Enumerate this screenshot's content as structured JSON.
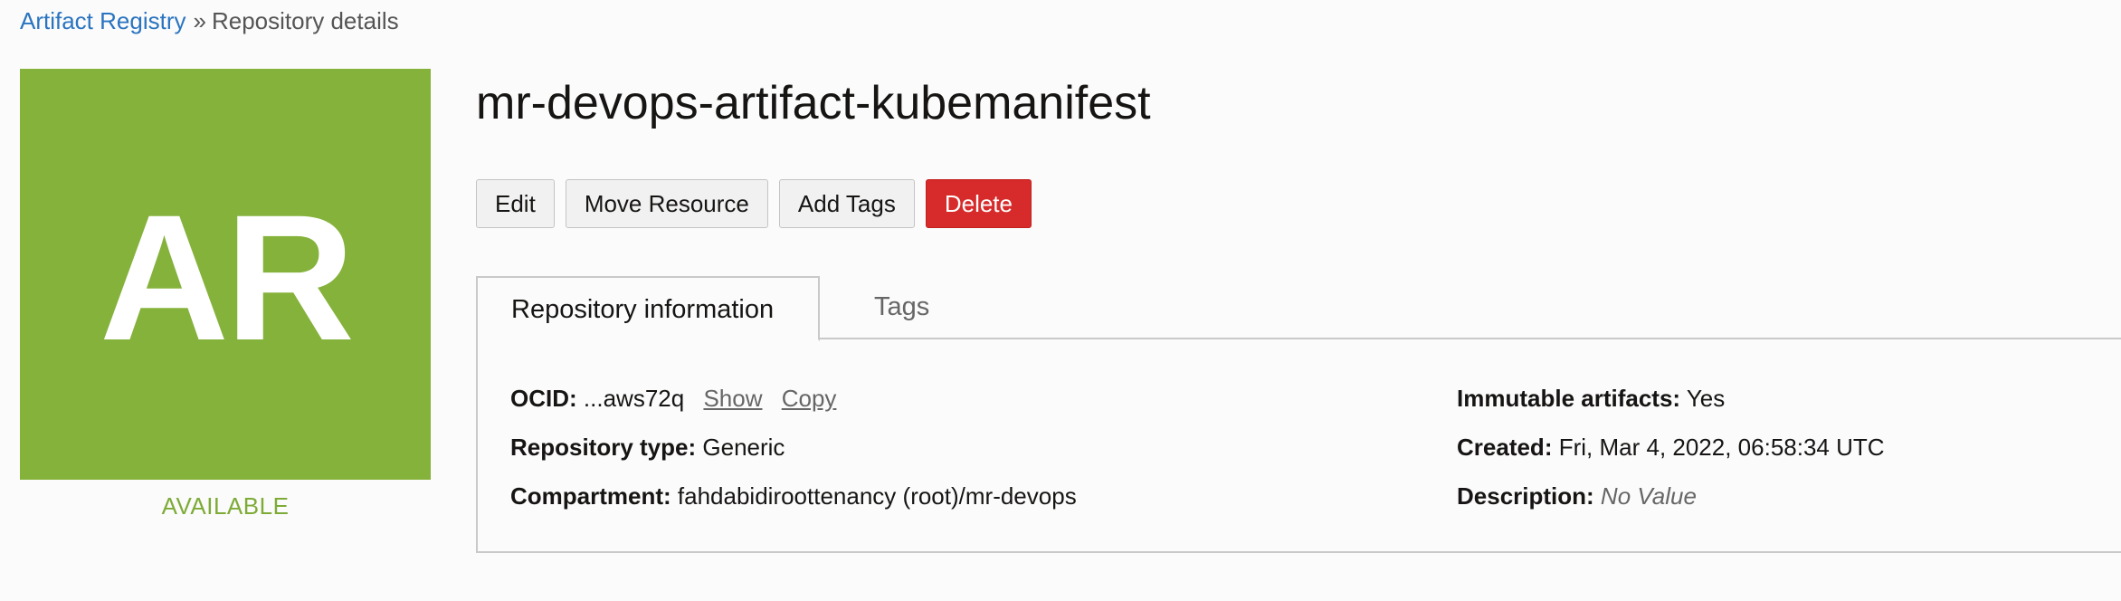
{
  "breadcrumb": {
    "parent": "Artifact Registry",
    "separator": "»",
    "current": "Repository details"
  },
  "badge": {
    "initials": "AR",
    "color": "#85b23b",
    "status": "AVAILABLE",
    "status_color": "#7eab37"
  },
  "title": "mr-devops-artifact-kubemanifest",
  "actions": {
    "edit": "Edit",
    "move": "Move Resource",
    "add_tags": "Add Tags",
    "delete": "Delete",
    "delete_color": "#d72a2a"
  },
  "tabs": {
    "active": "Repository information",
    "other": "Tags"
  },
  "info": {
    "ocid_label": "OCID:",
    "ocid_value": "...aws72q",
    "show_link": "Show",
    "copy_link": "Copy",
    "type_label": "Repository type:",
    "type_value": "Generic",
    "compartment_label": "Compartment:",
    "compartment_value": "fahdabidiroottenancy (root)/mr-devops",
    "immutable_label": "Immutable artifacts:",
    "immutable_value": "Yes",
    "created_label": "Created:",
    "created_value": "Fri, Mar 4, 2022, 06:58:34 UTC",
    "description_label": "Description:",
    "description_value": "No Value"
  }
}
